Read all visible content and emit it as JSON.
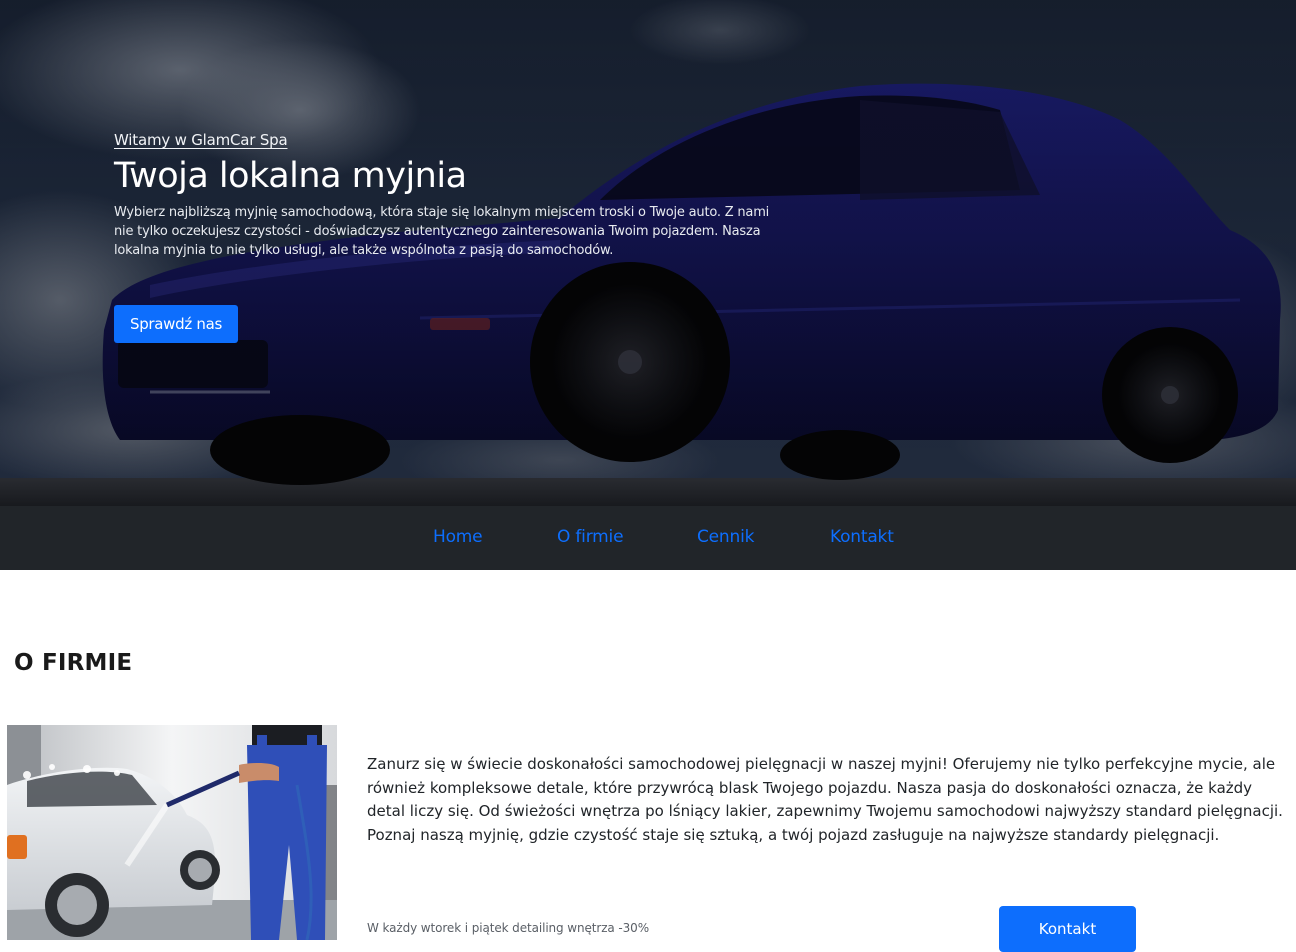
{
  "hero": {
    "greeting": "Witamy w GlamCar Spa",
    "title": "Twoja lokalna myjnia",
    "description": "Wybierz najbliższą myjnię samochodową, która staje się lokalnym miejscem troski o Twoje auto. Z nami nie tylko oczekujesz czystości - doświadczysz autentycznego zainteresowania Twoim pojazdem. Nasza lokalna myjnia to nie tylko usługi, ale także wspólnota z pasją do samochodów.",
    "cta_label": "Sprawdź nas"
  },
  "nav": {
    "items": [
      {
        "label": "Home"
      },
      {
        "label": "O firmie"
      },
      {
        "label": "Cennik"
      },
      {
        "label": "Kontakt"
      }
    ]
  },
  "about": {
    "title": "O FIRMIE",
    "text": "Zanurz się w świecie doskonałości samochodowej pielęgnacji w naszej myjni! Oferujemy nie tylko perfekcyjne mycie, ale również kompleksowe detale, które przywrócą blask Twojego pojazdu. Nasza pasja do doskonałości oznacza, że każdy detal liczy się. Od świeżości wnętrza po lśniący lakier, zapewnimy Twojemu samochodowi najwyższy standard pielęgnacji. Poznaj naszą myjnię, gdzie czystość staje się sztuką, a twój pojazd zasługuje na najwyższe standardy pielęgnacji.",
    "promo": "W każdy wtorek i piątek detailing wnętrza -30%",
    "contact_label": "Kontakt"
  },
  "colors": {
    "accent": "#0d6efd",
    "nav_background": "#212529",
    "text_dark": "#212529"
  },
  "icons": {
    "hero_image": "blue-sports-car-photo",
    "about_image": "car-wash-worker-photo"
  }
}
